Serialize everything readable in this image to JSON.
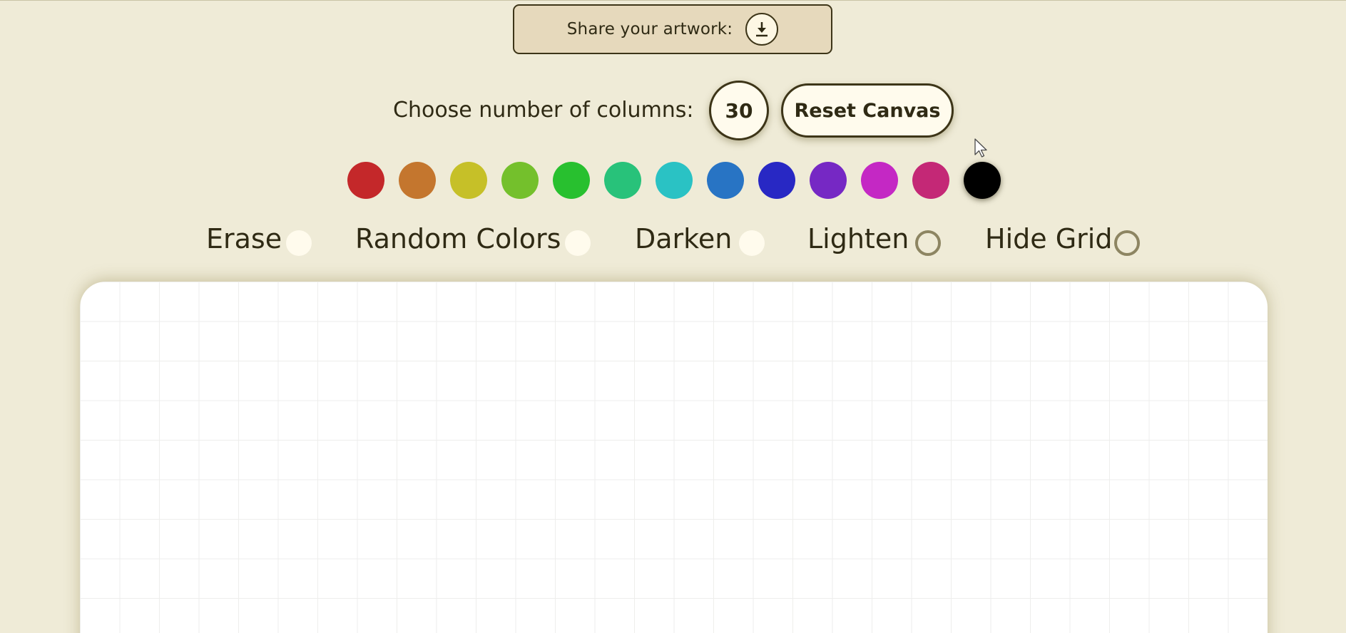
{
  "share": {
    "label": "Share your artwork:",
    "button_icon": "download-icon"
  },
  "columns": {
    "label": "Choose number of columns:",
    "value": "30"
  },
  "reset": {
    "label": "Reset Canvas"
  },
  "palette": {
    "colors": [
      "#c4282a",
      "#c4762e",
      "#c6c028",
      "#74c02c",
      "#28c02f",
      "#28c27a",
      "#2ac2c4",
      "#2874c4",
      "#2828c4",
      "#7628c4",
      "#c428c4",
      "#c42876",
      "#000000"
    ],
    "selected": "#000000"
  },
  "modes": [
    {
      "label": "Erase",
      "state": "off"
    },
    {
      "label": "Random Colors",
      "state": "off"
    },
    {
      "label": "Darken",
      "state": "off"
    },
    {
      "label": "Lighten",
      "state": "ring"
    },
    {
      "label": "Hide Grid",
      "state": "ring"
    }
  ],
  "colors": {
    "background": "#efebd7",
    "panel": "#e6d9bc",
    "border": "#3d3518",
    "text": "#2f2a14"
  }
}
